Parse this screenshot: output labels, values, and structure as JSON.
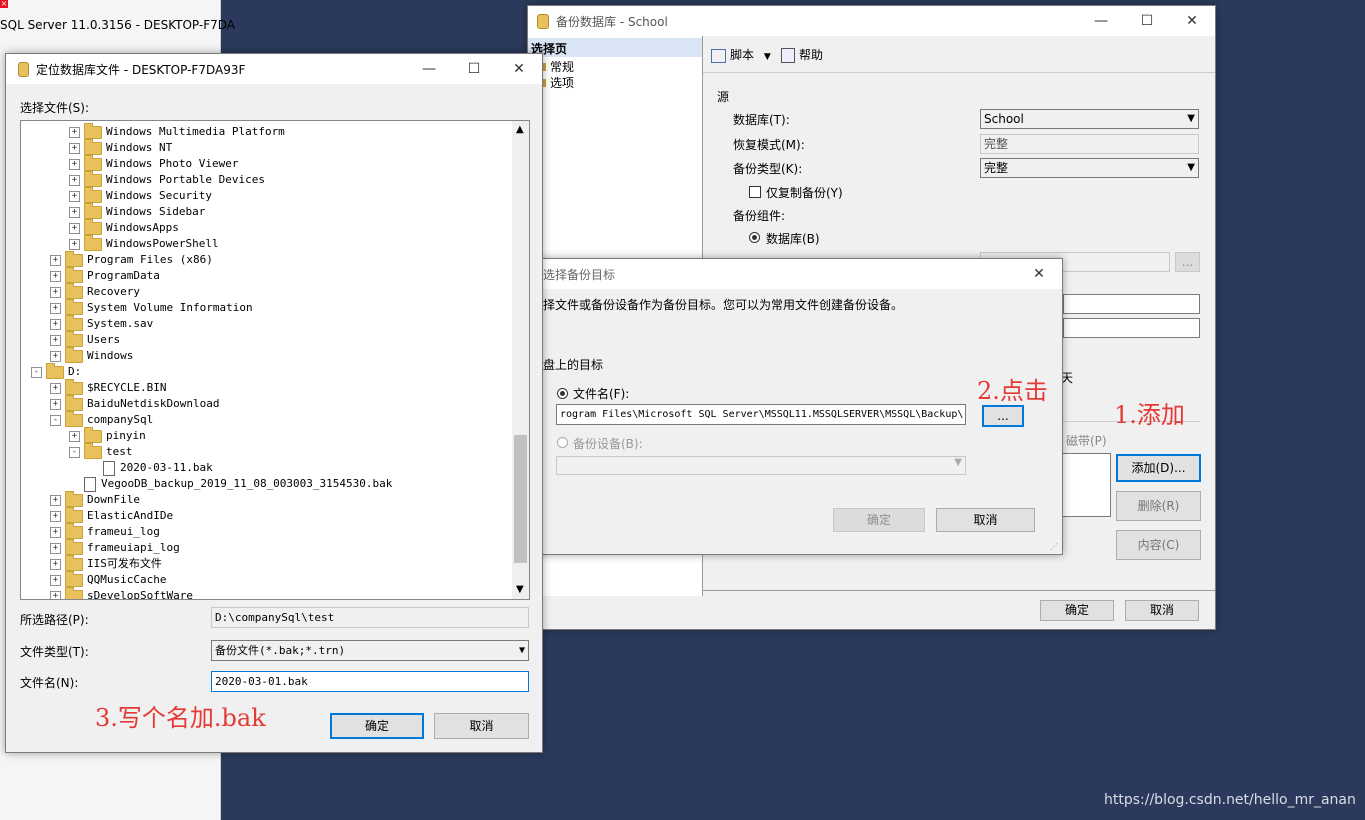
{
  "background_window": {
    "title": "SQL Server 11.0.3156 - DESKTOP-F7DA"
  },
  "backup_window": {
    "title": "备份数据库 - School",
    "select_page_header": "选择页",
    "pages": [
      "常规",
      "选项"
    ],
    "toolbar": {
      "script": "脚本",
      "help": "帮助"
    },
    "source_header": "源",
    "database_label": "数据库(T):",
    "database_value": "School",
    "recovery_label": "恢复模式(M):",
    "recovery_value": "完整",
    "backup_type_label": "备份类型(K):",
    "backup_type_value": "完整",
    "copy_only_label": "仅复制备份(Y)",
    "component_label": "备份组件:",
    "database_radio": "数据库(B)",
    "day_fragment": "天",
    "tape_label": "磁带(P)",
    "add_button": "添加(D)...",
    "remove_button": "删除(R)",
    "contents_button": "内容(C)",
    "ok": "确定",
    "cancel": "取消",
    "browse": "..."
  },
  "target_dialog": {
    "title": "选择备份目标",
    "description": "择文件或备份设备作为备份目标。您可以为常用文件创建备份设备。",
    "disk_target_label": "盘上的目标",
    "file_name_label": "文件名(F):",
    "file_name_value": "rogram Files\\Microsoft SQL Server\\MSSQL11.MSSQLSERVER\\MSSQL\\Backup\\",
    "browse_button": "...",
    "backup_device_label": "备份设备(B):",
    "ok": "确定",
    "cancel": "取消"
  },
  "locate_dialog": {
    "title": "定位数据库文件 - DESKTOP-F7DA93F",
    "select_file_label": "选择文件(S):",
    "tree": [
      {
        "label": "Windows Multimedia Platform",
        "level": 2,
        "type": "folder",
        "expander": "+"
      },
      {
        "label": "Windows NT",
        "level": 2,
        "type": "folder",
        "expander": "+"
      },
      {
        "label": "Windows Photo Viewer",
        "level": 2,
        "type": "folder",
        "expander": "+"
      },
      {
        "label": "Windows Portable Devices",
        "level": 2,
        "type": "folder",
        "expander": "+"
      },
      {
        "label": "Windows Security",
        "level": 2,
        "type": "folder",
        "expander": "+"
      },
      {
        "label": "Windows Sidebar",
        "level": 2,
        "type": "folder",
        "expander": "+"
      },
      {
        "label": "WindowsApps",
        "level": 2,
        "type": "folder",
        "expander": "+"
      },
      {
        "label": "WindowsPowerShell",
        "level": 2,
        "type": "folder",
        "expander": "+"
      },
      {
        "label": "Program Files (x86)",
        "level": 1,
        "type": "folder",
        "expander": "+"
      },
      {
        "label": "ProgramData",
        "level": 1,
        "type": "folder",
        "expander": "+"
      },
      {
        "label": "Recovery",
        "level": 1,
        "type": "folder",
        "expander": "+"
      },
      {
        "label": "System Volume Information",
        "level": 1,
        "type": "folder",
        "expander": "+"
      },
      {
        "label": "System.sav",
        "level": 1,
        "type": "folder",
        "expander": "+"
      },
      {
        "label": "Users",
        "level": 1,
        "type": "folder",
        "expander": "+"
      },
      {
        "label": "Windows",
        "level": 1,
        "type": "folder",
        "expander": "+"
      },
      {
        "label": "D:",
        "level": 0,
        "type": "folder",
        "expander": "-"
      },
      {
        "label": "$RECYCLE.BIN",
        "level": 1,
        "type": "folder",
        "expander": "+"
      },
      {
        "label": "BaiduNetdiskDownload",
        "level": 1,
        "type": "folder",
        "expander": "+"
      },
      {
        "label": "companySql",
        "level": 1,
        "type": "folder",
        "expander": "-"
      },
      {
        "label": "pinyin",
        "level": 2,
        "type": "folder",
        "expander": "+"
      },
      {
        "label": "test",
        "level": 2,
        "type": "folder",
        "expander": "-"
      },
      {
        "label": "2020-03-11.bak",
        "level": 3,
        "type": "file",
        "expander": ""
      },
      {
        "label": "VegooDB_backup_2019_11_08_003003_3154530.bak",
        "level": 2,
        "type": "file",
        "expander": ""
      },
      {
        "label": "DownFile",
        "level": 1,
        "type": "folder",
        "expander": "+"
      },
      {
        "label": "ElasticAndIDe",
        "level": 1,
        "type": "folder",
        "expander": "+"
      },
      {
        "label": "frameui_log",
        "level": 1,
        "type": "folder",
        "expander": "+"
      },
      {
        "label": "frameuiapi_log",
        "level": 1,
        "type": "folder",
        "expander": "+"
      },
      {
        "label": "IIS可发布文件",
        "level": 1,
        "type": "folder",
        "expander": "+"
      },
      {
        "label": "QQMusicCache",
        "level": 1,
        "type": "folder",
        "expander": "+"
      },
      {
        "label": "sDevelopSoftWare",
        "level": 1,
        "type": "folder",
        "expander": "+"
      }
    ],
    "path_label": "所选路径(P):",
    "path_value": "D:\\companySql\\test",
    "file_type_label": "文件类型(T):",
    "file_type_value": "备份文件(*.bak;*.trn)",
    "file_name_label": "文件名(N):",
    "file_name_value": "2020-03-01.bak",
    "ok": "确定",
    "cancel": "取消"
  },
  "annotations": {
    "step1": "1.添加",
    "step2": "2.点击",
    "step3": "3.写个名加.bak"
  },
  "watermark": "https://blog.csdn.net/hello_mr_anan",
  "colors": {
    "annotation": "#e53935",
    "desktop": "#2b3a5c",
    "focus": "#0078d7"
  }
}
